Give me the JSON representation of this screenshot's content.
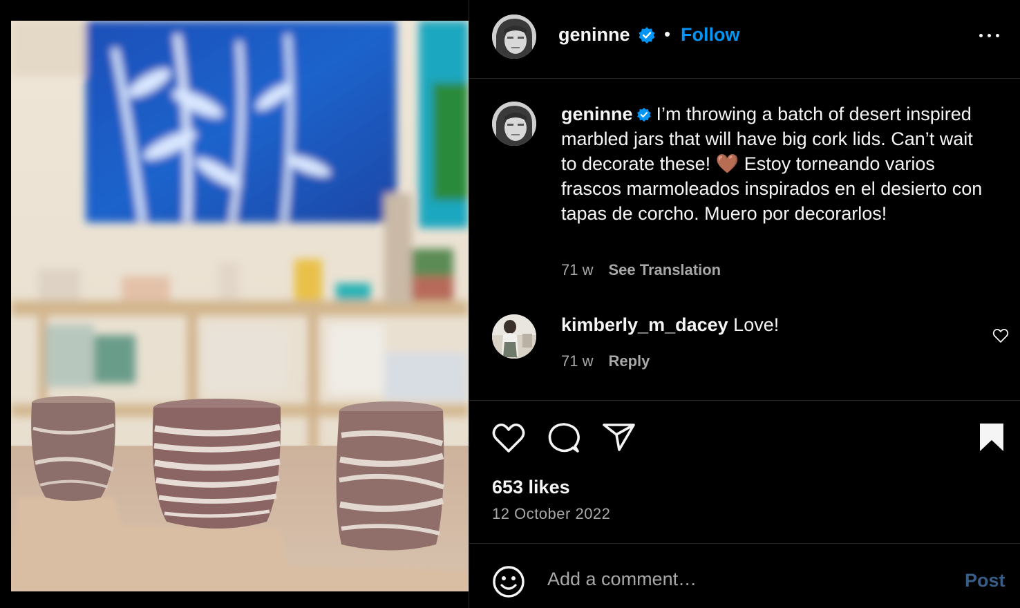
{
  "post": {
    "username": "geninne",
    "follow_label": "Follow",
    "separator": "•"
  },
  "caption": {
    "username": "geninne",
    "text": "I’m throwing a batch of desert inspired marbled jars that will have big cork lids. Can’t wait to decorate these! 🤎 Estoy torneando varios frascos marmoleados inspirados en el desierto con tapas de corcho. Muero por decorarlos!",
    "age": "71 w",
    "translate_label": "See Translation"
  },
  "comments": [
    {
      "username": "kimberly_m_dacey",
      "text": "Love!",
      "age": "71 w",
      "reply_label": "Reply"
    }
  ],
  "stats": {
    "likes": "653 likes",
    "date": "12 October 2022"
  },
  "composer": {
    "placeholder": "Add a comment…",
    "post_label": "Post"
  },
  "colors": {
    "background": "#000000",
    "accent": "#0095f6",
    "muted": "#a8a8a8",
    "post_disabled": "#385e87"
  },
  "icons": [
    "verified-badge-icon",
    "more-options-icon",
    "heart-icon",
    "comment-icon",
    "share-icon",
    "bookmark-icon",
    "emoji-icon",
    "like-comment-icon"
  ]
}
